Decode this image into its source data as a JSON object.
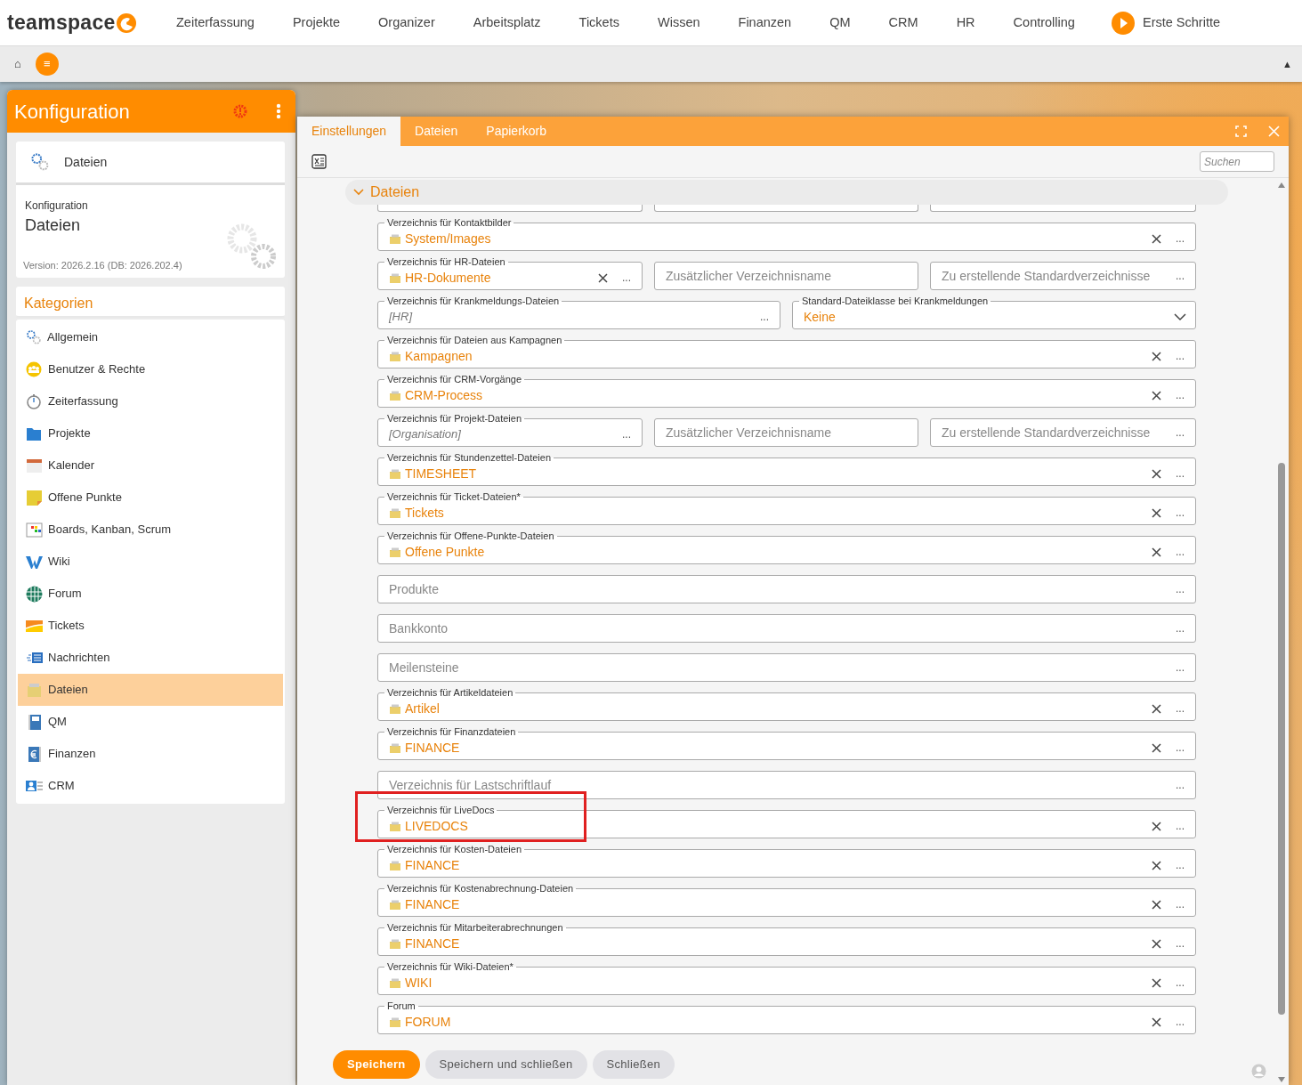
{
  "nav": {
    "logo": "teamspace",
    "items": [
      "Zeiterfassung",
      "Projekte",
      "Organizer",
      "Arbeitsplatz",
      "Tickets",
      "Wissen",
      "Finanzen",
      "QM",
      "CRM",
      "HR",
      "Controlling"
    ],
    "first_steps": "Erste Schritte"
  },
  "subbar": {
    "home": "⌂",
    "menu": "≡",
    "collapse": "▲"
  },
  "sidebar": {
    "title": "Konfiguration",
    "current": {
      "name": "Dateien",
      "caption": "Konfiguration",
      "title": "Dateien",
      "version": "Version: 2026.2.16 (DB: 2026.202.4)"
    },
    "categories_title": "Kategorien",
    "categories": [
      {
        "label": "Allgemein",
        "selected": false
      },
      {
        "label": "Benutzer & Rechte",
        "selected": false
      },
      {
        "label": "Zeiterfassung",
        "selected": false
      },
      {
        "label": "Projekte",
        "selected": false
      },
      {
        "label": "Kalender",
        "selected": false
      },
      {
        "label": "Offene Punkte",
        "selected": false
      },
      {
        "label": "Boards, Kanban, Scrum",
        "selected": false
      },
      {
        "label": "Wiki",
        "selected": false
      },
      {
        "label": "Forum",
        "selected": false
      },
      {
        "label": "Tickets",
        "selected": false
      },
      {
        "label": "Nachrichten",
        "selected": false
      },
      {
        "label": "Dateien",
        "selected": true
      },
      {
        "label": "QM",
        "selected": false
      },
      {
        "label": "Finanzen",
        "selected": false
      },
      {
        "label": "CRM",
        "selected": false
      }
    ]
  },
  "dialog": {
    "tabs": [
      {
        "label": "Einstellungen",
        "selected": true
      },
      {
        "label": "Dateien",
        "selected": false
      },
      {
        "label": "Papierkorb",
        "selected": false
      }
    ],
    "search": {
      "placeholder": "Suchen"
    },
    "section": {
      "title": "Dateien",
      "expanded": true
    },
    "rows": [
      {
        "highlighted": false,
        "fields": [
          {
            "kind": "clipped"
          },
          {
            "kind": "clipped"
          },
          {
            "kind": "clipped"
          }
        ]
      },
      {
        "highlighted": false,
        "fields": [
          {
            "kind": "folder",
            "label": "Verzeichnis für Kontaktbilder",
            "value": "System/Images",
            "clearable": true,
            "action": "..."
          }
        ]
      },
      {
        "highlighted": false,
        "fields": [
          {
            "kind": "folder",
            "label": "Verzeichnis für HR-Dateien",
            "value": "HR-Dokumente",
            "clearable": true,
            "action": "..."
          },
          {
            "kind": "empty",
            "placeholder": "Zusätzlicher Verzeichnisname",
            "clearable": false
          },
          {
            "kind": "empty",
            "placeholder": "Zu erstellende Standardverzeichnisse",
            "clearable": false,
            "action": "..."
          }
        ]
      },
      {
        "highlighted": false,
        "fields": [
          {
            "kind": "inherited",
            "label": "Verzeichnis für Krankmeldungs-Dateien",
            "value": "[HR]",
            "clearable": false,
            "action": "..."
          },
          {
            "kind": "select",
            "label": "Standard-Dateiklasse bei Krankmeldungen",
            "value": "Keine",
            "clearable": false
          }
        ]
      },
      {
        "highlighted": false,
        "fields": [
          {
            "kind": "folder",
            "label": "Verzeichnis für Dateien aus Kampagnen",
            "value": "Kampagnen",
            "clearable": true,
            "action": "..."
          }
        ]
      },
      {
        "highlighted": false,
        "fields": [
          {
            "kind": "folder",
            "label": "Verzeichnis für CRM-Vorgänge",
            "value": "CRM-Process",
            "clearable": true,
            "action": "..."
          }
        ]
      },
      {
        "highlighted": false,
        "fields": [
          {
            "kind": "inherited",
            "label": "Verzeichnis für Projekt-Dateien",
            "value": "[Organisation]",
            "clearable": false,
            "action": "..."
          },
          {
            "kind": "empty",
            "placeholder": "Zusätzlicher Verzeichnisname",
            "clearable": false
          },
          {
            "kind": "empty",
            "placeholder": "Zu erstellende Standardverzeichnisse",
            "clearable": false,
            "action": "..."
          }
        ]
      },
      {
        "highlighted": false,
        "fields": [
          {
            "kind": "folder",
            "label": "Verzeichnis für Stundenzettel-Dateien",
            "value": "TIMESHEET",
            "clearable": true,
            "action": "..."
          }
        ]
      },
      {
        "highlighted": false,
        "fields": [
          {
            "kind": "folder",
            "label": "Verzeichnis für Ticket-Dateien*",
            "value": "Tickets",
            "clearable": true,
            "action": "..."
          }
        ]
      },
      {
        "highlighted": false,
        "fields": [
          {
            "kind": "folder",
            "label": "Verzeichnis für Offene-Punkte-Dateien",
            "value": "Offene Punkte",
            "clearable": true,
            "action": "..."
          }
        ]
      },
      {
        "highlighted": false,
        "fields": [
          {
            "kind": "empty",
            "placeholder": "Produkte",
            "clearable": false,
            "action": "..."
          }
        ]
      },
      {
        "highlighted": false,
        "fields": [
          {
            "kind": "empty",
            "placeholder": "Bankkonto",
            "clearable": false,
            "action": "..."
          }
        ]
      },
      {
        "highlighted": false,
        "fields": [
          {
            "kind": "empty",
            "placeholder": "Meilensteine",
            "clearable": false,
            "action": "..."
          }
        ]
      },
      {
        "highlighted": false,
        "fields": [
          {
            "kind": "folder",
            "label": "Verzeichnis für Artikeldateien",
            "value": "Artikel",
            "clearable": true,
            "action": "..."
          }
        ]
      },
      {
        "highlighted": false,
        "fields": [
          {
            "kind": "folder",
            "label": "Verzeichnis für Finanzdateien",
            "value": "FINANCE",
            "clearable": true,
            "action": "..."
          }
        ]
      },
      {
        "highlighted": false,
        "fields": [
          {
            "kind": "empty",
            "placeholder": "Verzeichnis für Lastschriftlauf",
            "clearable": false,
            "action": "..."
          }
        ]
      },
      {
        "highlighted": true,
        "fields": [
          {
            "kind": "folder",
            "label": "Verzeichnis für LiveDocs",
            "value": "LIVEDOCS",
            "clearable": true,
            "action": "..."
          }
        ]
      },
      {
        "highlighted": false,
        "fields": [
          {
            "kind": "folder",
            "label": "Verzeichnis für Kosten-Dateien",
            "value": "FINANCE",
            "clearable": true,
            "action": "..."
          }
        ]
      },
      {
        "highlighted": false,
        "fields": [
          {
            "kind": "folder",
            "label": "Verzeichnis für Kostenabrechnung-Dateien",
            "value": "FINANCE",
            "clearable": true,
            "action": "..."
          }
        ]
      },
      {
        "highlighted": false,
        "fields": [
          {
            "kind": "folder",
            "label": "Verzeichnis für Mitarbeiterabrechnungen",
            "value": "FINANCE",
            "clearable": true,
            "action": "..."
          }
        ]
      },
      {
        "highlighted": false,
        "fields": [
          {
            "kind": "folder",
            "label": "Verzeichnis für Wiki-Dateien*",
            "value": "WIKI",
            "clearable": true,
            "action": "..."
          }
        ]
      },
      {
        "highlighted": false,
        "fields": [
          {
            "kind": "folder",
            "label": "Forum",
            "value": "FORUM",
            "clearable": true,
            "action": "..."
          }
        ]
      }
    ],
    "buttons": [
      {
        "label": "Speichern",
        "primary": true
      },
      {
        "label": "Speichern und schließen",
        "primary": false
      },
      {
        "label": "Schließen",
        "primary": false
      }
    ]
  }
}
